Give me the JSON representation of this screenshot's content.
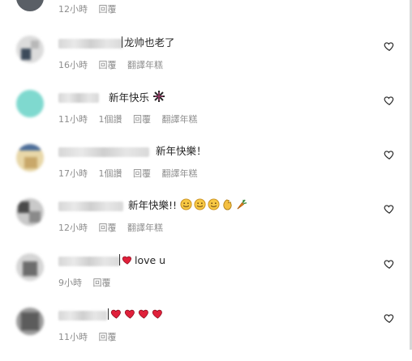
{
  "top_comment": {
    "time": "12小時",
    "reply": "回覆"
  },
  "comments": [
    {
      "text": "龙帅也老了",
      "time": "16小時",
      "likes": "",
      "reply": "回覆",
      "translate": "翻譯年糕"
    },
    {
      "text": "新年快乐",
      "time": "11小時",
      "likes": "1個讚",
      "reply": "回覆",
      "translate": "翻譯年糕"
    },
    {
      "text": "新年快樂！",
      "time": "17小時",
      "likes": "1個讚",
      "reply": "回覆",
      "translate": "翻譯年糕"
    },
    {
      "text": "新年快樂!!",
      "time": "12小時",
      "likes": "",
      "reply": "回覆",
      "translate": "翻譯年糕"
    },
    {
      "text": "love u",
      "time": "9小時",
      "likes": "",
      "reply": "回覆",
      "translate": ""
    },
    {
      "text": "",
      "time": "11小時",
      "likes": "",
      "reply": "回覆",
      "translate": ""
    }
  ],
  "colors": {
    "heart_red": "#e0203a",
    "meta_gray": "#8e8e8e",
    "text": "#262626"
  },
  "icons": {
    "like": "heart-outline-icon",
    "emoji_smile": "smiling-face-icon",
    "emoji_hands": "clapping-hands-icon",
    "emoji_carrot": "carrot-icon",
    "emoji_firework": "firework-icon",
    "emoji_heart": "red-heart-icon"
  }
}
